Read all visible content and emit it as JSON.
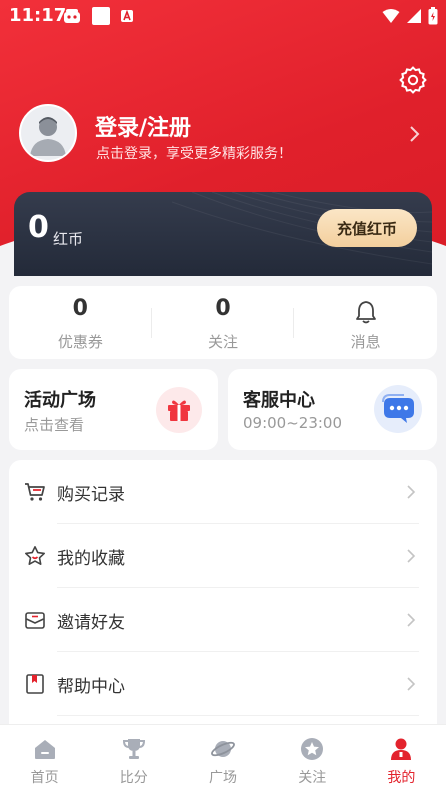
{
  "status_bar": {
    "time": "11:17"
  },
  "profile": {
    "title": "登录/注册",
    "subtitle": "点击登录，享受更多精彩服务！"
  },
  "wallet": {
    "coins": "0",
    "unit": "红币",
    "recharge_label": "充值红币"
  },
  "stats": [
    {
      "value": "0",
      "label": "优惠券"
    },
    {
      "value": "0",
      "label": "关注"
    },
    {
      "label": "消息",
      "icon": "bell-icon"
    }
  ],
  "cards": {
    "activity": {
      "title": "活动广场",
      "subtitle": "点击查看",
      "icon": "gift-icon"
    },
    "service": {
      "title": "客服中心",
      "subtitle": "09:00~23:00",
      "icon": "chat-icon"
    }
  },
  "menu": [
    {
      "label": "购买记录",
      "icon": "cart-icon"
    },
    {
      "label": "我的收藏",
      "icon": "star-outline-icon"
    },
    {
      "label": "邀请好友",
      "icon": "envelope-icon"
    },
    {
      "label": "帮助中心",
      "icon": "bookmark-icon"
    }
  ],
  "tabs": [
    {
      "label": "首页",
      "icon": "home-icon"
    },
    {
      "label": "比分",
      "icon": "trophy-icon"
    },
    {
      "label": "广场",
      "icon": "planet-icon"
    },
    {
      "label": "关注",
      "icon": "star-icon"
    },
    {
      "label": "我的",
      "icon": "user-icon",
      "active": true
    }
  ],
  "colors": {
    "brand": "#e3232d",
    "wallet": "#2a3140",
    "recharge": "#f6d8ac"
  }
}
